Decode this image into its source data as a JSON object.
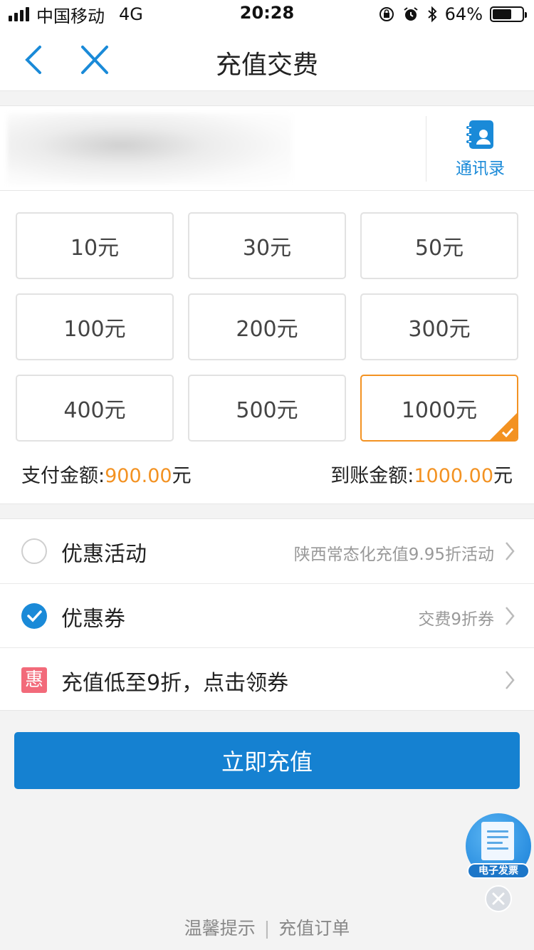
{
  "status_bar": {
    "carrier": "中国移动",
    "network": "4G",
    "time": "20:28",
    "battery": "64%",
    "battery_level": 0.64,
    "icons": [
      "signal-icon",
      "rotation-lock-icon",
      "alarm-icon",
      "bluetooth-icon",
      "battery-icon"
    ]
  },
  "nav": {
    "title": "充值交费",
    "back_icon": "chevron-left-icon",
    "close_icon": "close-icon"
  },
  "phone": {
    "contacts_label": "通讯录",
    "contacts_icon": "address-book-icon"
  },
  "amounts": {
    "options": [
      "10元",
      "30元",
      "50元",
      "100元",
      "200元",
      "300元",
      "400元",
      "500元",
      "1000元"
    ],
    "selected": "1000元"
  },
  "payment": {
    "pay_label": "支付金额:",
    "pay_value": "900.00",
    "pay_unit": "元",
    "receive_label": "到账金额:",
    "receive_value": "1000.00",
    "receive_unit": "元"
  },
  "offers": {
    "activity_label": "优惠活动",
    "activity_value": "陕西常态化充值9.95折活动",
    "activity_checked": false,
    "coupon_label": "优惠券",
    "coupon_value": "交费9折券",
    "coupon_checked": true,
    "promo_badge": "惠",
    "promo_label": "充值低至9折，点击领券"
  },
  "submit_label": "立即充值",
  "invoice": {
    "label": "电子发票",
    "icon": "receipt-icon"
  },
  "footer": {
    "tips": "温馨提示",
    "separator": "|",
    "orders": "充值订单"
  },
  "colors": {
    "brand_blue": "#1581d1",
    "accent_orange": "#f39222",
    "promo_red": "#f26a7a"
  }
}
